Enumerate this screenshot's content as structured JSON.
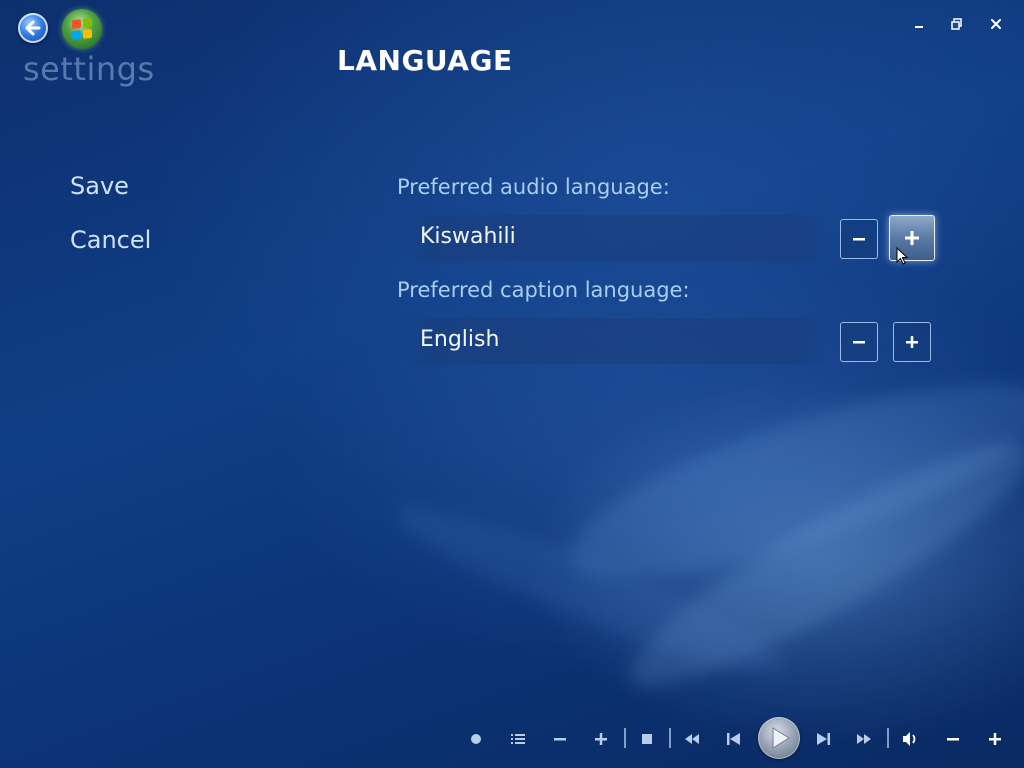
{
  "app": {
    "title": "settings",
    "page_title": "LANGUAGE"
  },
  "nav": {
    "back_icon": "back-arrow-icon",
    "logo_icon": "windows-logo-icon"
  },
  "window_controls": [
    "minimize-icon",
    "restore-icon",
    "close-icon"
  ],
  "menu": {
    "save_label": "Save",
    "cancel_label": "Cancel"
  },
  "settings": {
    "audio": {
      "label": "Preferred audio language:",
      "value": "Kiswahili"
    },
    "caption": {
      "label": "Preferred caption language:",
      "value": "English"
    }
  },
  "transport": {
    "icons": [
      "record-icon",
      "guide-icon",
      "channel-down-icon",
      "channel-up-icon",
      "stop-icon",
      "rewind-icon",
      "previous-icon",
      "play-icon",
      "next-icon",
      "fast-forward-icon",
      "mute-icon",
      "volume-down-icon",
      "volume-up-icon"
    ]
  },
  "colors": {
    "background": "#103e86",
    "label": "#a9cdf4",
    "menu_text": "#cfe3ff",
    "text": "#ffffff"
  }
}
